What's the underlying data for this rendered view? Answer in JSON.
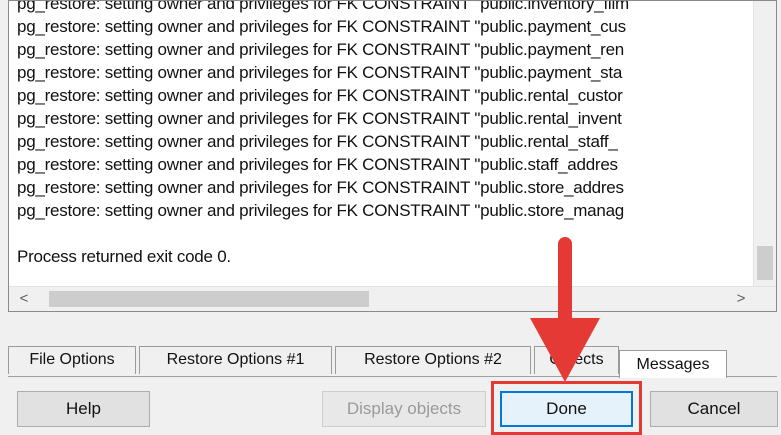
{
  "log": {
    "lines": [
      "pg_restore: setting owner and privileges for FK CONSTRAINT \"public.inventory_film",
      "pg_restore: setting owner and privileges for FK CONSTRAINT \"public.payment_cus",
      "pg_restore: setting owner and privileges for FK CONSTRAINT \"public.payment_ren",
      "pg_restore: setting owner and privileges for FK CONSTRAINT \"public.payment_sta",
      "pg_restore: setting owner and privileges for FK CONSTRAINT \"public.rental_custor",
      "pg_restore: setting owner and privileges for FK CONSTRAINT \"public.rental_invent",
      "pg_restore: setting owner and privileges for FK CONSTRAINT \"public.rental_staff_",
      "pg_restore: setting owner and privileges for FK CONSTRAINT \"public.staff_addres",
      "pg_restore: setting owner and privileges for FK CONSTRAINT \"public.store_addres",
      "pg_restore: setting owner and privileges for FK CONSTRAINT \"public.store_manag"
    ],
    "exit_message": "Process returned exit code 0."
  },
  "scrollbar": {
    "left_arrow": "<",
    "right_arrow": ">",
    "down_arrow": "v"
  },
  "tabs": [
    {
      "label": "File Options",
      "active": false
    },
    {
      "label": "Restore Options #1",
      "active": false
    },
    {
      "label": "Restore Options #2",
      "active": false
    },
    {
      "label": "Objects",
      "active": false
    },
    {
      "label": "Messages",
      "active": true
    }
  ],
  "buttons": {
    "help": "Help",
    "display_objects": "Display objects",
    "done": "Done",
    "cancel": "Cancel"
  },
  "colors": {
    "annotation": "#e53935",
    "focus": "#0078d7"
  }
}
